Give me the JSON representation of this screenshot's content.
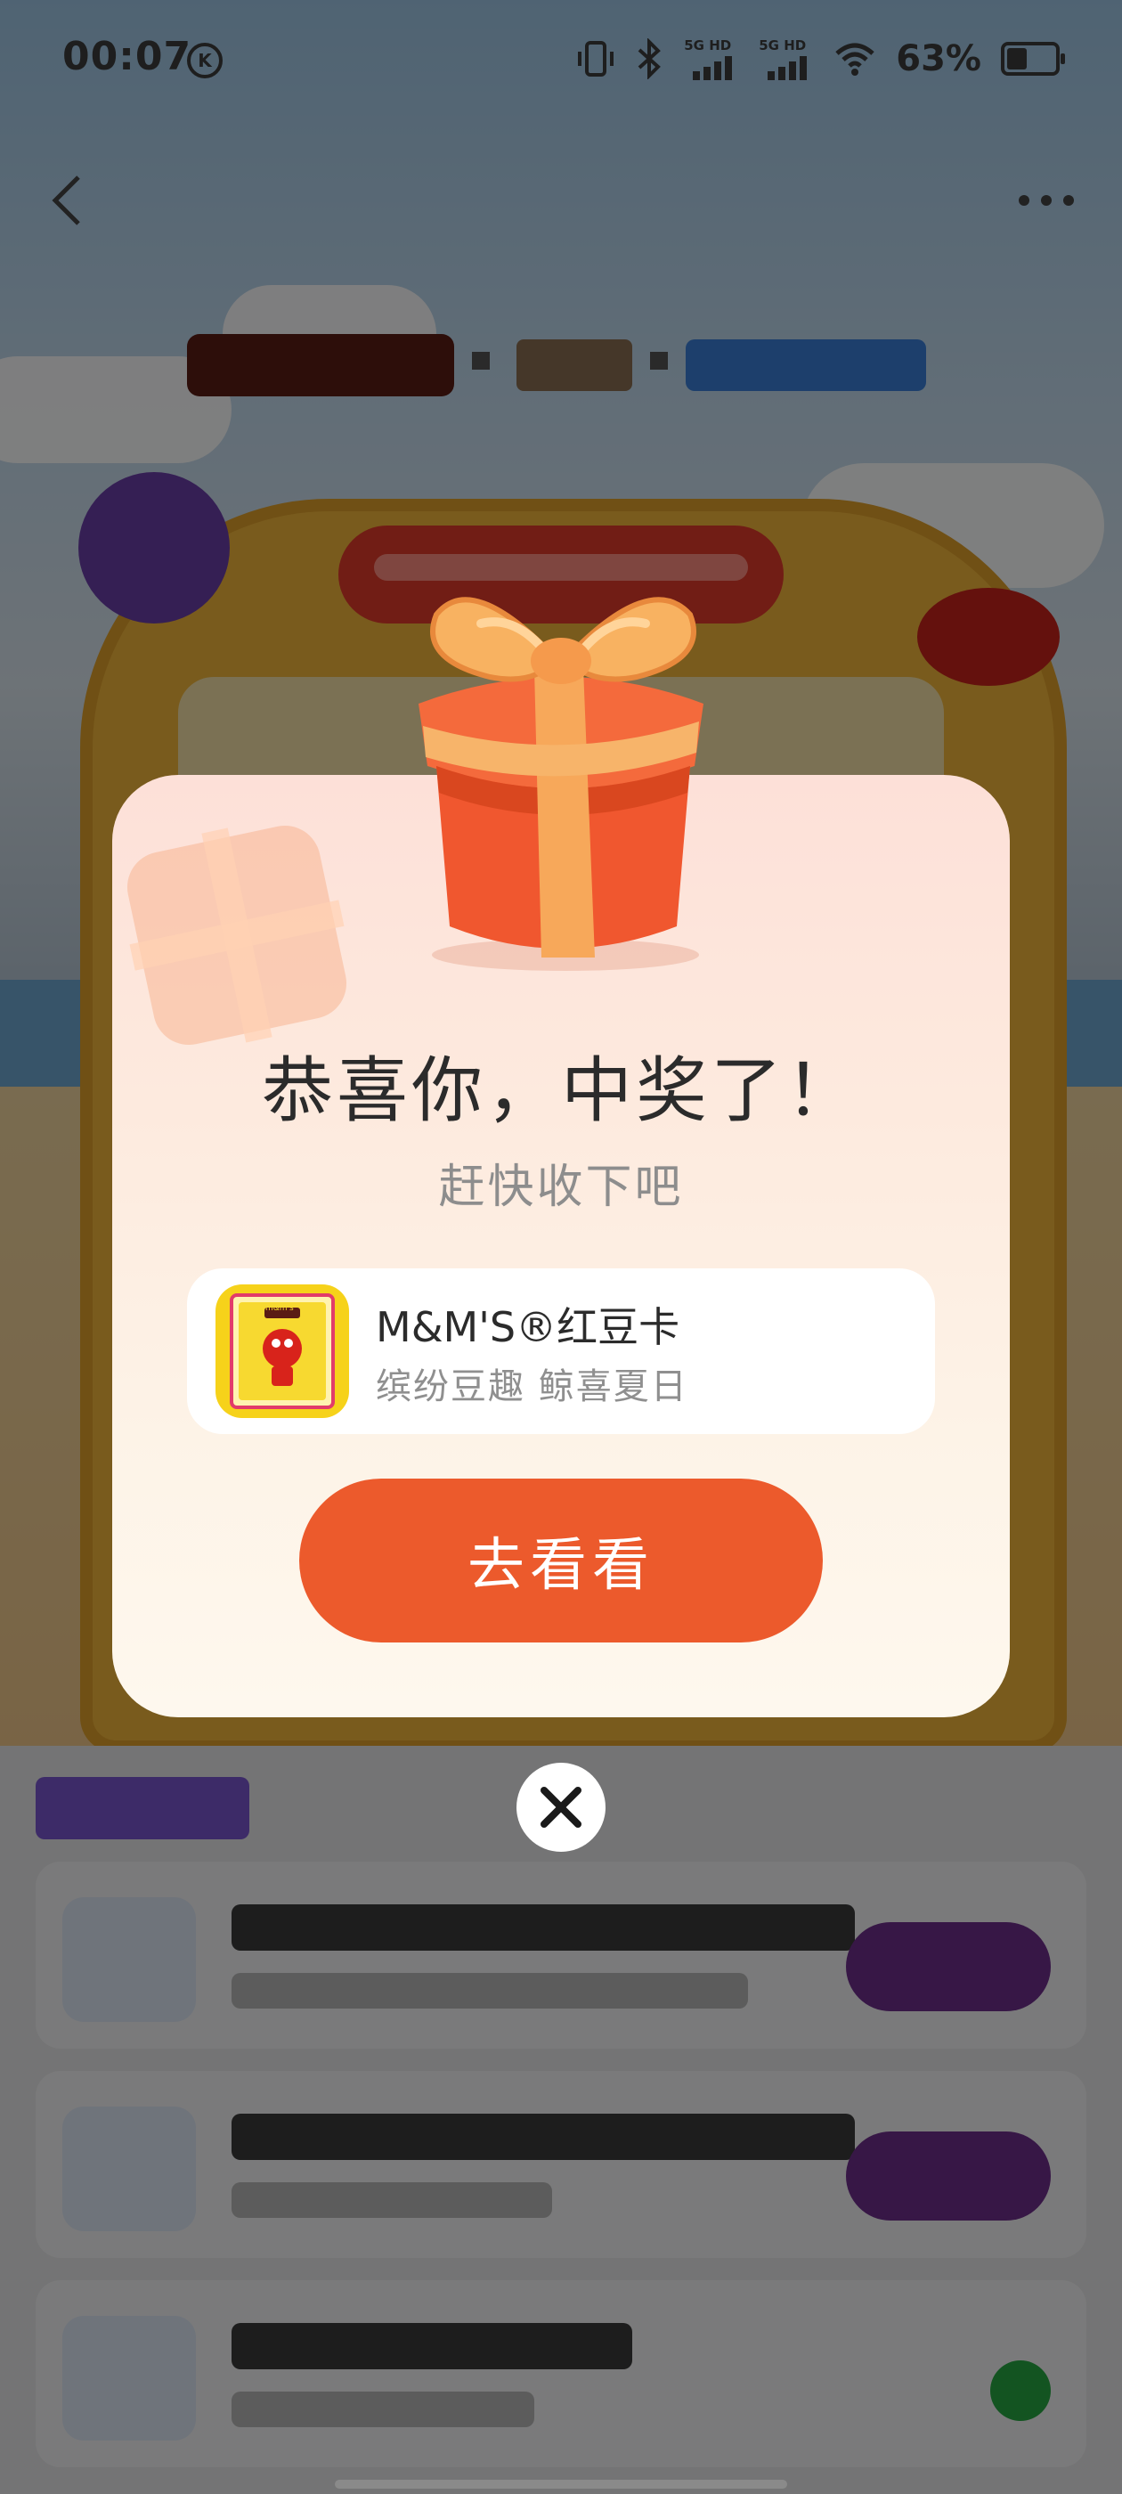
{
  "status_bar": {
    "time": "00:07",
    "time_badge": "K",
    "battery_percent": "63%",
    "network_1": "5G HD",
    "network_2": "5G HD",
    "icons": [
      "vibrate-icon",
      "bluetooth-icon",
      "signal-icon",
      "signal-icon",
      "wifi-icon",
      "battery-icon"
    ]
  },
  "nav": {
    "back_icon": "chevron-left-icon",
    "more_icon": "more-horizontal-icon"
  },
  "modal": {
    "title": "恭喜你，中奖了！",
    "subtitle": "赶快收下吧",
    "prize": {
      "name": "M&M'S®红豆卡",
      "description": "缤纷豆趣 鲸喜夏日",
      "thumb_label": "m&m's"
    },
    "cta_label": "去看看",
    "close_icon": "close-icon"
  },
  "colors": {
    "cta": "#ec5a2c",
    "modal_top": "#fde0d8",
    "modal_bottom": "#fef8ee",
    "gift_box": "#f0572f",
    "gift_ribbon": "#f7a85a"
  }
}
